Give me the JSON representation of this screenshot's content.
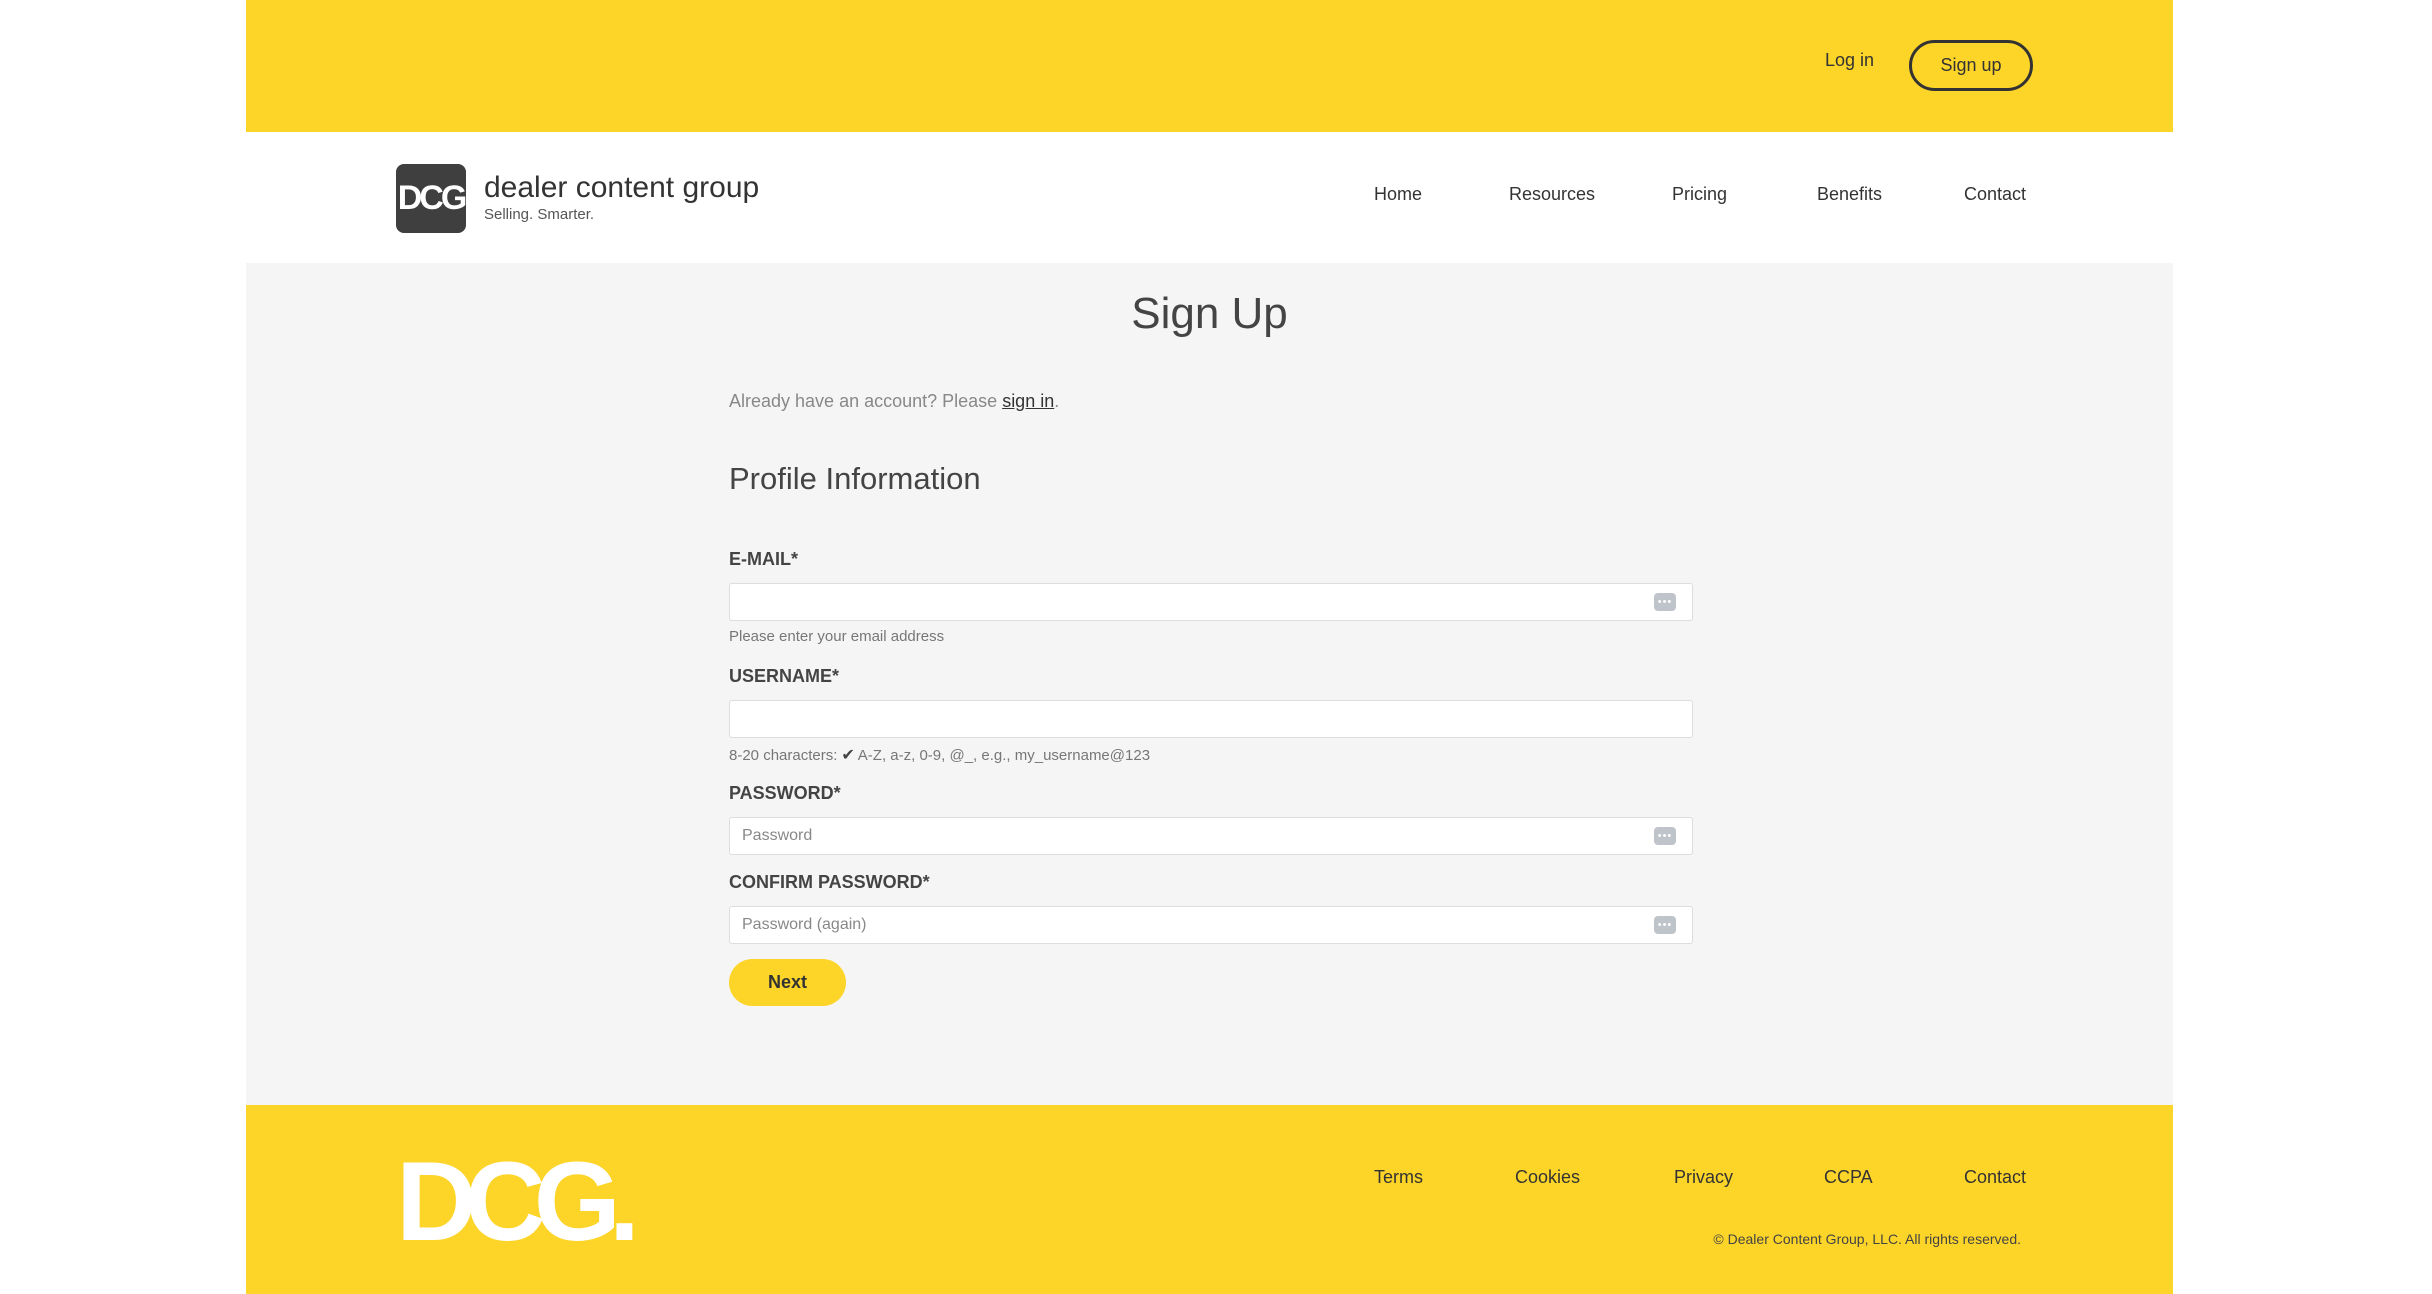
{
  "topbar": {
    "login": "Log in",
    "signup": "Sign up"
  },
  "brand": {
    "mark": "DCG",
    "name": "dealer content group",
    "tagline": "Selling. Smarter."
  },
  "nav": {
    "items": [
      "Home",
      "Resources",
      "Pricing",
      "Benefits",
      "Contact"
    ]
  },
  "page": {
    "title": "Sign Up"
  },
  "account": {
    "prompt": "Already have an account? Please ",
    "link": "sign in",
    "suffix": "."
  },
  "section": {
    "title": "Profile Information"
  },
  "fields": {
    "email": {
      "label": "E-MAIL*",
      "value": "",
      "placeholder": "",
      "helper": "Please enter your email address"
    },
    "username": {
      "label": "USERNAME*",
      "value": "",
      "placeholder": "",
      "helper_prefix": "8-20 characters:",
      "helper_rest": "A-Z, a-z, 0-9, @_, e.g., my_username@123"
    },
    "password": {
      "label": "PASSWORD*",
      "value": "",
      "placeholder": "Password"
    },
    "confirm": {
      "label": "CONFIRM PASSWORD*",
      "value": "",
      "placeholder": "Password (again)"
    }
  },
  "actions": {
    "next": "Next"
  },
  "footer": {
    "mark": "DCG.",
    "links": [
      "Terms",
      "Cookies",
      "Privacy",
      "CCPA",
      "Contact"
    ],
    "copyright": "© Dealer Content Group, LLC. All rights reserved."
  },
  "icons": {
    "field_icon": "password-manager-icon",
    "check": "check-icon"
  },
  "colors": {
    "brand_yellow": "#fdd428",
    "dark": "#333333",
    "panel": "#f5f5f5"
  }
}
